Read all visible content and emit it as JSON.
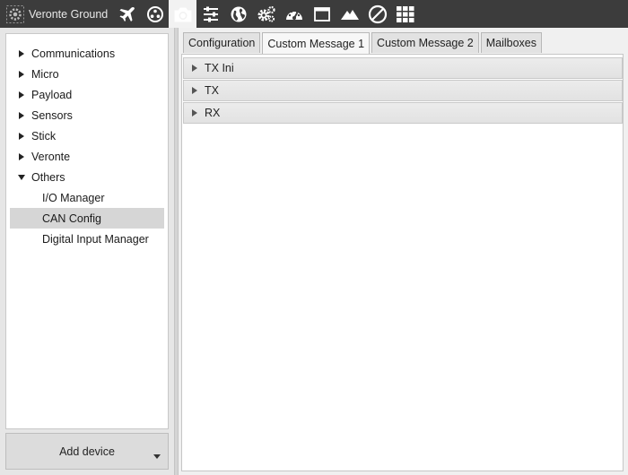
{
  "app": {
    "title": "Veronte Ground"
  },
  "toolbar": {
    "icons": [
      {
        "name": "airplane-icon",
        "active": false
      },
      {
        "name": "connections-icon",
        "active": false
      },
      {
        "name": "camera-icon",
        "active": true
      },
      {
        "name": "sliders-icon",
        "active": false
      },
      {
        "name": "globe-icon",
        "active": false
      },
      {
        "name": "gears-icon",
        "active": false
      },
      {
        "name": "gauge-icon",
        "active": false
      },
      {
        "name": "window-icon",
        "active": false
      },
      {
        "name": "mountains-icon",
        "active": false
      },
      {
        "name": "forbidden-icon",
        "active": false
      },
      {
        "name": "grid-icon",
        "active": false
      }
    ]
  },
  "tree": {
    "items": [
      {
        "label": "Communications",
        "expanded": false
      },
      {
        "label": "Micro",
        "expanded": false
      },
      {
        "label": "Payload",
        "expanded": false
      },
      {
        "label": "Sensors",
        "expanded": false
      },
      {
        "label": "Stick",
        "expanded": false
      },
      {
        "label": "Veronte",
        "expanded": false
      },
      {
        "label": "Others",
        "expanded": true
      }
    ],
    "children": [
      {
        "label": "I/O Manager",
        "selected": false
      },
      {
        "label": "CAN Config",
        "selected": true
      },
      {
        "label": "Digital Input Manager",
        "selected": false
      }
    ]
  },
  "add_device": {
    "label": "Add device"
  },
  "tabs": [
    {
      "label": "Configuration",
      "active": false
    },
    {
      "label": "Custom Message 1",
      "active": true
    },
    {
      "label": "Custom Message 2",
      "active": false
    },
    {
      "label": "Mailboxes",
      "active": false
    }
  ],
  "sections": [
    {
      "label": "TX Ini"
    },
    {
      "label": "TX"
    },
    {
      "label": "RX"
    }
  ],
  "colors": {
    "toolbar_bg": "#3c3c3c",
    "icon_white": "#ffffff",
    "selected_row": "#d6d6d6"
  }
}
